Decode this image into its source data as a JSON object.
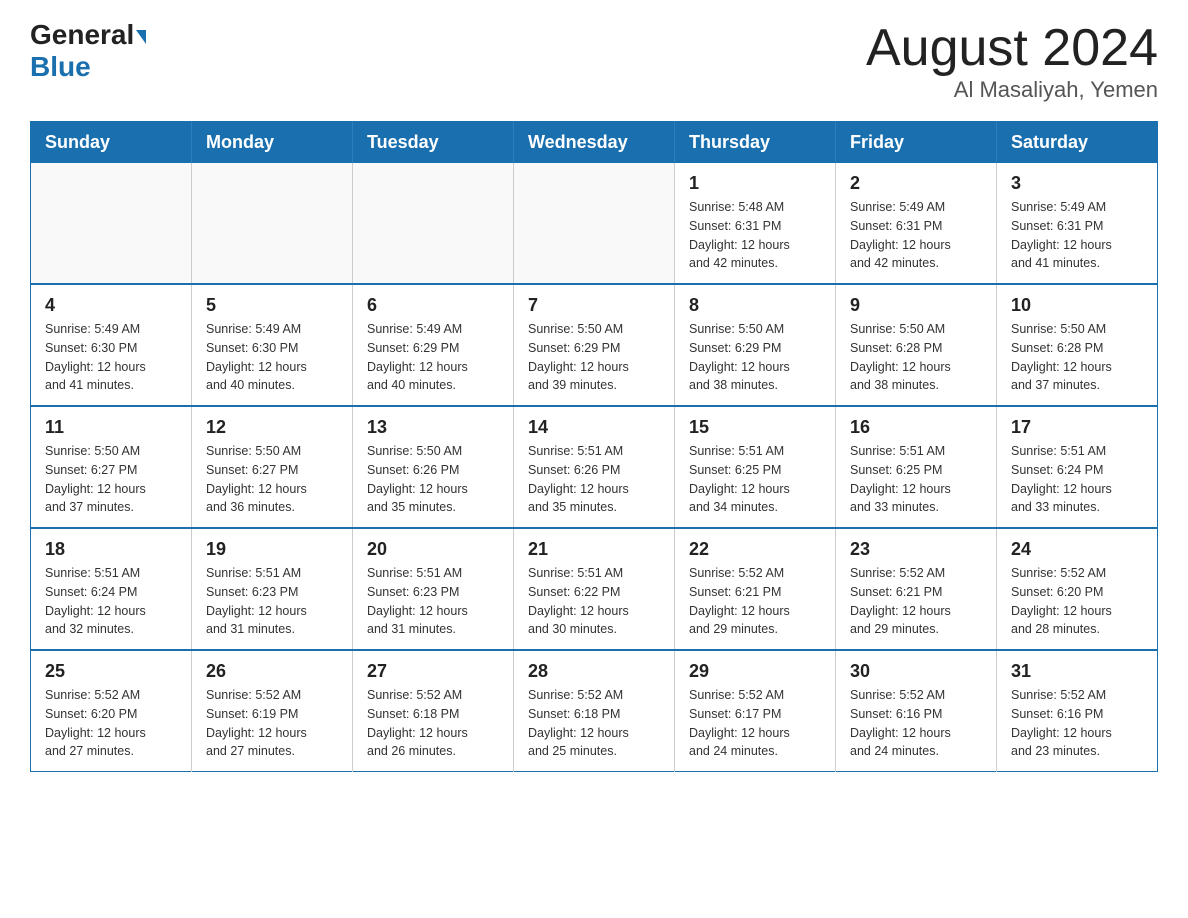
{
  "header": {
    "logo_general": "General",
    "logo_blue": "Blue",
    "title": "August 2024",
    "subtitle": "Al Masaliyah, Yemen"
  },
  "weekdays": [
    "Sunday",
    "Monday",
    "Tuesday",
    "Wednesday",
    "Thursday",
    "Friday",
    "Saturday"
  ],
  "weeks": [
    [
      {
        "day": "",
        "info": ""
      },
      {
        "day": "",
        "info": ""
      },
      {
        "day": "",
        "info": ""
      },
      {
        "day": "",
        "info": ""
      },
      {
        "day": "1",
        "info": "Sunrise: 5:48 AM\nSunset: 6:31 PM\nDaylight: 12 hours\nand 42 minutes."
      },
      {
        "day": "2",
        "info": "Sunrise: 5:49 AM\nSunset: 6:31 PM\nDaylight: 12 hours\nand 42 minutes."
      },
      {
        "day": "3",
        "info": "Sunrise: 5:49 AM\nSunset: 6:31 PM\nDaylight: 12 hours\nand 41 minutes."
      }
    ],
    [
      {
        "day": "4",
        "info": "Sunrise: 5:49 AM\nSunset: 6:30 PM\nDaylight: 12 hours\nand 41 minutes."
      },
      {
        "day": "5",
        "info": "Sunrise: 5:49 AM\nSunset: 6:30 PM\nDaylight: 12 hours\nand 40 minutes."
      },
      {
        "day": "6",
        "info": "Sunrise: 5:49 AM\nSunset: 6:29 PM\nDaylight: 12 hours\nand 40 minutes."
      },
      {
        "day": "7",
        "info": "Sunrise: 5:50 AM\nSunset: 6:29 PM\nDaylight: 12 hours\nand 39 minutes."
      },
      {
        "day": "8",
        "info": "Sunrise: 5:50 AM\nSunset: 6:29 PM\nDaylight: 12 hours\nand 38 minutes."
      },
      {
        "day": "9",
        "info": "Sunrise: 5:50 AM\nSunset: 6:28 PM\nDaylight: 12 hours\nand 38 minutes."
      },
      {
        "day": "10",
        "info": "Sunrise: 5:50 AM\nSunset: 6:28 PM\nDaylight: 12 hours\nand 37 minutes."
      }
    ],
    [
      {
        "day": "11",
        "info": "Sunrise: 5:50 AM\nSunset: 6:27 PM\nDaylight: 12 hours\nand 37 minutes."
      },
      {
        "day": "12",
        "info": "Sunrise: 5:50 AM\nSunset: 6:27 PM\nDaylight: 12 hours\nand 36 minutes."
      },
      {
        "day": "13",
        "info": "Sunrise: 5:50 AM\nSunset: 6:26 PM\nDaylight: 12 hours\nand 35 minutes."
      },
      {
        "day": "14",
        "info": "Sunrise: 5:51 AM\nSunset: 6:26 PM\nDaylight: 12 hours\nand 35 minutes."
      },
      {
        "day": "15",
        "info": "Sunrise: 5:51 AM\nSunset: 6:25 PM\nDaylight: 12 hours\nand 34 minutes."
      },
      {
        "day": "16",
        "info": "Sunrise: 5:51 AM\nSunset: 6:25 PM\nDaylight: 12 hours\nand 33 minutes."
      },
      {
        "day": "17",
        "info": "Sunrise: 5:51 AM\nSunset: 6:24 PM\nDaylight: 12 hours\nand 33 minutes."
      }
    ],
    [
      {
        "day": "18",
        "info": "Sunrise: 5:51 AM\nSunset: 6:24 PM\nDaylight: 12 hours\nand 32 minutes."
      },
      {
        "day": "19",
        "info": "Sunrise: 5:51 AM\nSunset: 6:23 PM\nDaylight: 12 hours\nand 31 minutes."
      },
      {
        "day": "20",
        "info": "Sunrise: 5:51 AM\nSunset: 6:23 PM\nDaylight: 12 hours\nand 31 minutes."
      },
      {
        "day": "21",
        "info": "Sunrise: 5:51 AM\nSunset: 6:22 PM\nDaylight: 12 hours\nand 30 minutes."
      },
      {
        "day": "22",
        "info": "Sunrise: 5:52 AM\nSunset: 6:21 PM\nDaylight: 12 hours\nand 29 minutes."
      },
      {
        "day": "23",
        "info": "Sunrise: 5:52 AM\nSunset: 6:21 PM\nDaylight: 12 hours\nand 29 minutes."
      },
      {
        "day": "24",
        "info": "Sunrise: 5:52 AM\nSunset: 6:20 PM\nDaylight: 12 hours\nand 28 minutes."
      }
    ],
    [
      {
        "day": "25",
        "info": "Sunrise: 5:52 AM\nSunset: 6:20 PM\nDaylight: 12 hours\nand 27 minutes."
      },
      {
        "day": "26",
        "info": "Sunrise: 5:52 AM\nSunset: 6:19 PM\nDaylight: 12 hours\nand 27 minutes."
      },
      {
        "day": "27",
        "info": "Sunrise: 5:52 AM\nSunset: 6:18 PM\nDaylight: 12 hours\nand 26 minutes."
      },
      {
        "day": "28",
        "info": "Sunrise: 5:52 AM\nSunset: 6:18 PM\nDaylight: 12 hours\nand 25 minutes."
      },
      {
        "day": "29",
        "info": "Sunrise: 5:52 AM\nSunset: 6:17 PM\nDaylight: 12 hours\nand 24 minutes."
      },
      {
        "day": "30",
        "info": "Sunrise: 5:52 AM\nSunset: 6:16 PM\nDaylight: 12 hours\nand 24 minutes."
      },
      {
        "day": "31",
        "info": "Sunrise: 5:52 AM\nSunset: 6:16 PM\nDaylight: 12 hours\nand 23 minutes."
      }
    ]
  ]
}
